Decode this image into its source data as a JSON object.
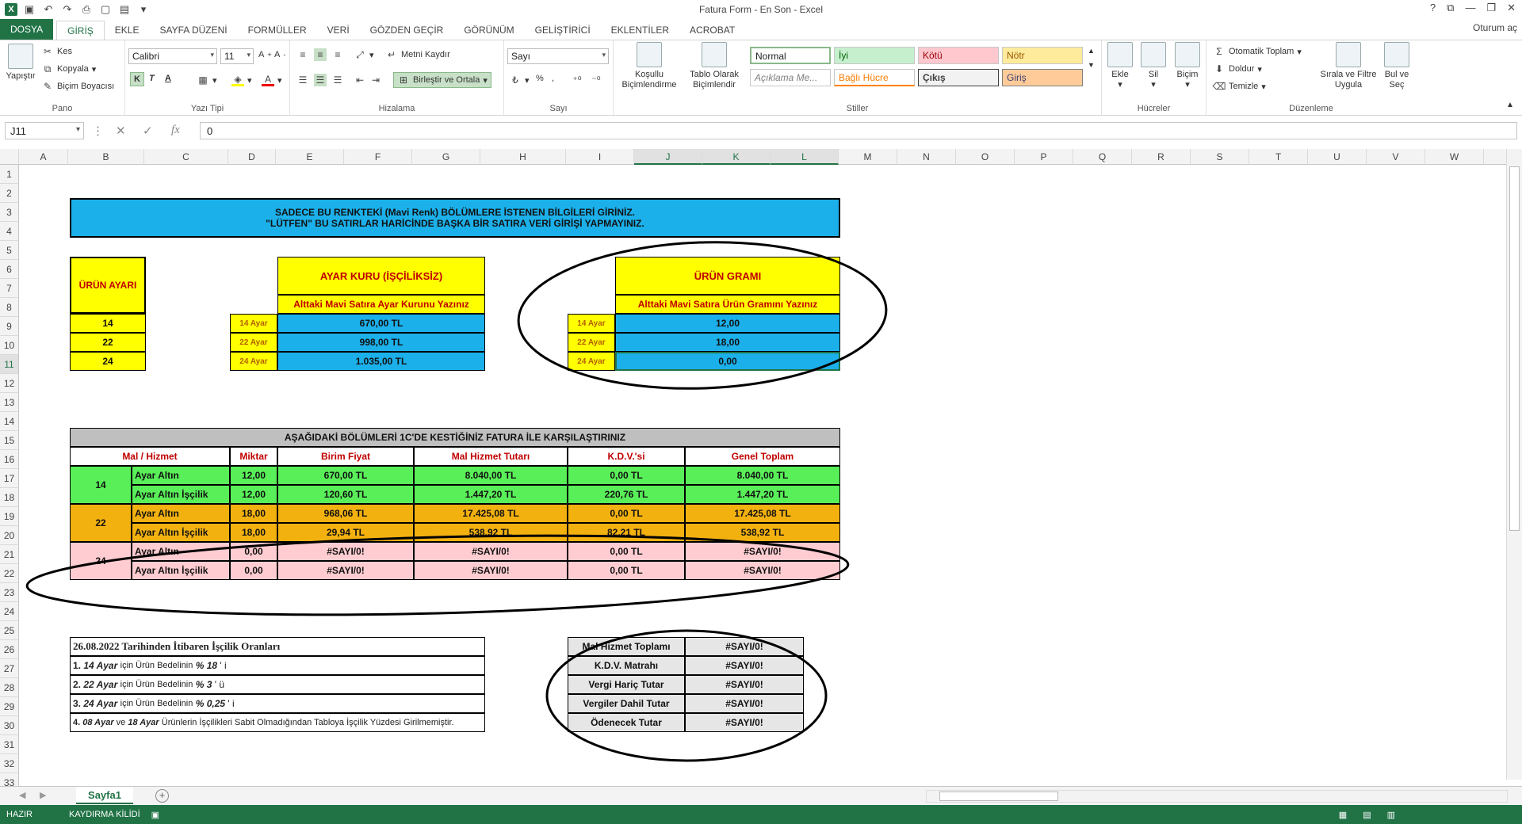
{
  "window": {
    "title": "Fatura Form - En Son - Excel",
    "help": "?",
    "signin": "Oturum aç"
  },
  "tabs": [
    "DOSYA",
    "GİRİŞ",
    "EKLE",
    "SAYFA DÜZENİ",
    "FORMÜLLER",
    "VERİ",
    "GÖZDEN GEÇİR",
    "GÖRÜNÜM",
    "GELİŞTİRİCİ",
    "EKLENTİLER",
    "ACROBAT"
  ],
  "ribbon": {
    "pano": {
      "label": "Pano",
      "paste": "Yapıştır",
      "cut": "Kes",
      "copy": "Kopyala",
      "format_painter": "Biçim Boyacısı"
    },
    "font": {
      "label": "Yazı Tipi",
      "name": "Calibri",
      "size": "11",
      "bold": "K",
      "italic": "T",
      "underline": "A"
    },
    "align": {
      "label": "Hizalama",
      "wrap": "Metni Kaydır",
      "merge": "Birleştir ve Ortala"
    },
    "number": {
      "label": "Sayı",
      "format": "Sayı",
      "percent": "%"
    },
    "styles": {
      "label": "Stiller",
      "cond": "Koşullu Biçimlendirme",
      "table": "Tablo Olarak Biçimlendir",
      "normal": "Normal",
      "iyi": "İyi",
      "kotu": "Kötü",
      "notr": "Nötr",
      "aciklama": "Açıklama Me...",
      "bagli": "Bağlı Hücre",
      "cikis": "Çıkış",
      "giris": "Giriş"
    },
    "cells": {
      "label": "Hücreler",
      "insert": "Ekle",
      "delete": "Sil",
      "format": "Biçim"
    },
    "editing": {
      "label": "Düzenleme",
      "autosum": "Otomatik Toplam",
      "fill": "Doldur",
      "clear": "Temizle",
      "sort": "Sırala ve Filtre Uygula",
      "find": "Bul ve Seç"
    }
  },
  "formula_bar": {
    "name_box": "J11",
    "fx": "fx",
    "value": "0"
  },
  "columns": [
    "A",
    "B",
    "C",
    "D",
    "E",
    "F",
    "G",
    "H",
    "I",
    "J",
    "K",
    "L",
    "M",
    "N",
    "O",
    "P",
    "Q",
    "R",
    "S",
    "T",
    "U",
    "V",
    "W",
    "X"
  ],
  "rows": [
    "1",
    "2",
    "3",
    "4",
    "5",
    "6",
    "7",
    "8",
    "9",
    "10",
    "11",
    "12",
    "13",
    "14",
    "15",
    "16",
    "17",
    "18",
    "19",
    "20",
    "21",
    "22",
    "23",
    "24",
    "25",
    "26",
    "27",
    "28",
    "29",
    "30",
    "31",
    "32",
    "33"
  ],
  "sheet": {
    "banner_line1": "SADECE BU RENKTEKİ  (Mavi Renk) BÖLÜMLERE İSTENEN BİLGİLERİ GİRİNİZ.",
    "banner_line2": "\"LÜTFEN\" BU SATIRLAR HARİCİNDE BAŞKA BİR SATIRA VERİ GİRİŞİ YAPMAYINIZ.",
    "urun_ayari_title": "ÜRÜN AYARI",
    "ayarlar": [
      "14",
      "22",
      "24"
    ],
    "ayar_kuru_title": "AYAR KURU (İŞÇİLİKSİZ)",
    "ayar_kuru_sub": "Alttaki Mavi Satıra Ayar Kurunu Yazınız",
    "ayar_labels": [
      "14 Ayar",
      "22 Ayar",
      "24 Ayar"
    ],
    "ayar_kuru_values": [
      "670,00 TL",
      "998,00 TL",
      "1.035,00 TL"
    ],
    "urun_grami_title": "ÜRÜN GRAMI",
    "urun_grami_sub": "Alttaki Mavi Satıra Ürün Gramını Yazınız",
    "urun_grami_values": [
      "12,00",
      "18,00",
      "0,00"
    ],
    "invoice_title": "AŞAĞIDAKİ BÖLÜMLERİ 1C'DE KESTİĞİNİZ FATURA İLE KARŞILAŞTIRINIZ",
    "invoice_headers": [
      "Mal / Hizmet",
      "Miktar",
      "Birim Fiyat",
      "Mal Hizmet Tutarı",
      "K.D.V.'si",
      "Genel Toplam"
    ],
    "invoice_rows": [
      {
        "group": "14",
        "item": "Ayar Altın",
        "qty": "12,00",
        "price": "670,00 TL",
        "amount": "8.040,00 TL",
        "kdv": "0,00 TL",
        "total": "8.040,00 TL"
      },
      {
        "group": "14",
        "item": "Ayar Altın İşçilik",
        "qty": "12,00",
        "price": "120,60 TL",
        "amount": "1.447,20 TL",
        "kdv": "220,76 TL",
        "total": "1.447,20 TL"
      },
      {
        "group": "22",
        "item": "Ayar Altın",
        "qty": "18,00",
        "price": "968,06 TL",
        "amount": "17.425,08 TL",
        "kdv": "0,00 TL",
        "total": "17.425,08 TL"
      },
      {
        "group": "22",
        "item": "Ayar Altın İşçilik",
        "qty": "18,00",
        "price": "29,94 TL",
        "amount": "538,92 TL",
        "kdv": "82,21 TL",
        "total": "538,92 TL"
      },
      {
        "group": "24",
        "item": "Ayar Altın",
        "qty": "0,00",
        "price": "#SAYI/0!",
        "amount": "#SAYI/0!",
        "kdv": "0,00 TL",
        "total": "#SAYI/0!"
      },
      {
        "group": "24",
        "item": "Ayar Altın İşçilik",
        "qty": "0,00",
        "price": "#SAYI/0!",
        "amount": "#SAYI/0!",
        "kdv": "0,00 TL",
        "total": "#SAYI/0!"
      }
    ],
    "notes_title": "26.08.2022 Tarihinden İtibaren İşçilik Oranları",
    "notes": [
      {
        "num": "1.",
        "ayar": "14 Ayar",
        "mid": "için Ürün Bedelinin",
        "pct": "% 18",
        "tail": "' i"
      },
      {
        "num": "2.",
        "ayar": "22 Ayar",
        "mid": "için Ürün Bedelinin",
        "pct": "% 3",
        "tail": "' ü"
      },
      {
        "num": "3.",
        "ayar": "24 Ayar",
        "mid": "için Ürün Bedelinin",
        "pct": "% 0,25",
        "tail": "' i"
      }
    ],
    "note4_num": "4.",
    "note4_a": "08 Ayar",
    "note4_ve": "ve",
    "note4_b": "18 Ayar",
    "note4_tail": "Ürünlerin İşçilikleri Sabit Olmadığından Tabloya İşçilik Yüzdesi Girilmemiştir.",
    "summary": [
      {
        "label": "Mal Hizmet Toplamı",
        "value": "#SAYI/0!"
      },
      {
        "label": "K.D.V. Matrahı",
        "value": "#SAYI/0!"
      },
      {
        "label": "Vergi Hariç Tutar",
        "value": "#SAYI/0!"
      },
      {
        "label": "Vergiler Dahil Tutar",
        "value": "#SAYI/0!"
      },
      {
        "label": "Ödenecek Tutar",
        "value": "#SAYI/0!"
      }
    ]
  },
  "sheet_tab": "Sayfa1",
  "status": {
    "ready": "HAZIR",
    "scroll_lock": "KAYDIRMA KİLİDİ"
  },
  "colors": {
    "accent": "#217346",
    "blue_input": "#1cb0ea",
    "yellow": "#ffff00",
    "green": "#59ef59",
    "orange": "#f3b110",
    "pink": "#ffccd1"
  }
}
